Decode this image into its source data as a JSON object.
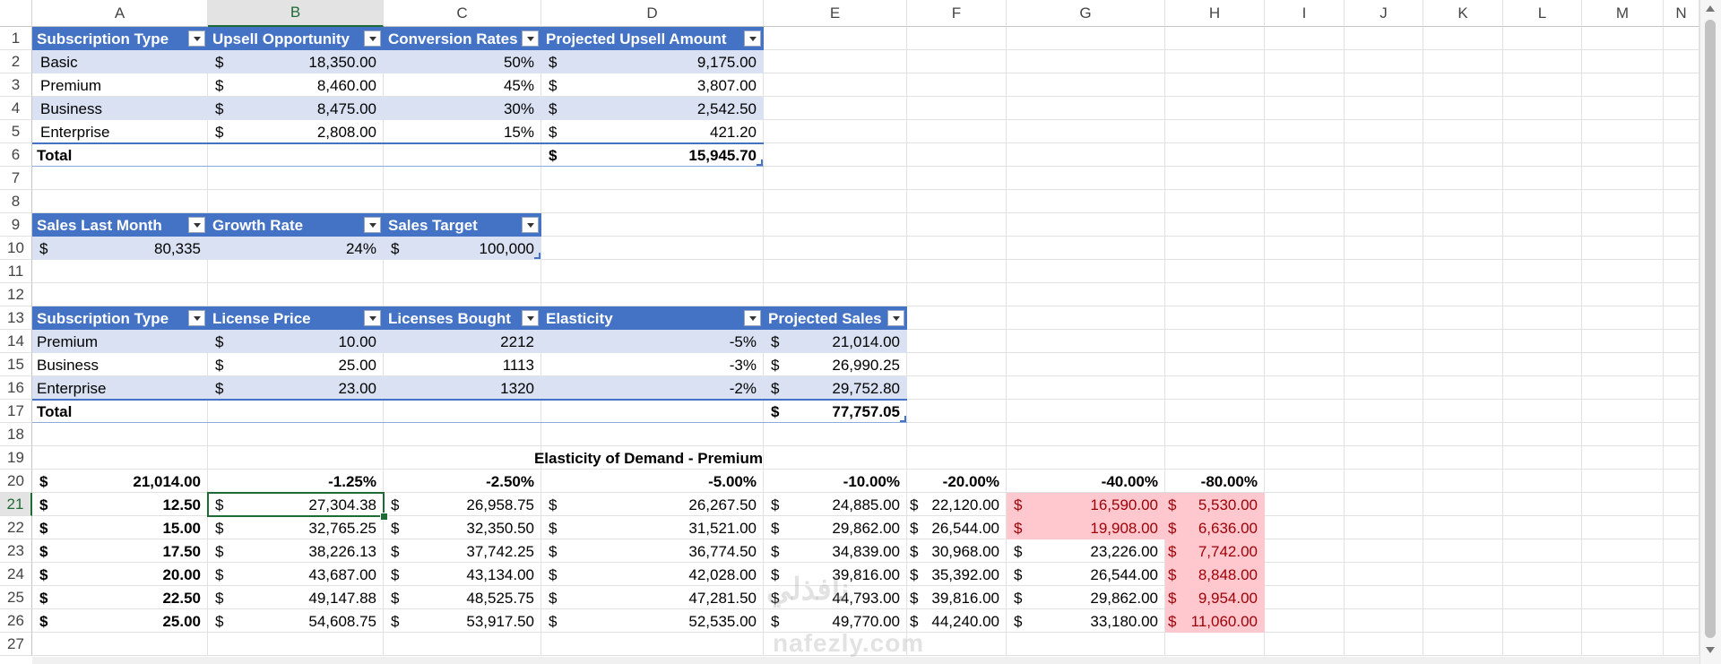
{
  "columns": [
    "A",
    "B",
    "C",
    "D",
    "E",
    "F",
    "G",
    "H",
    "I",
    "J",
    "K",
    "L",
    "M",
    "N"
  ],
  "rows": [
    "1",
    "2",
    "3",
    "4",
    "5",
    "6",
    "7",
    "8",
    "9",
    "10",
    "11",
    "12",
    "13",
    "14",
    "15",
    "16",
    "17",
    "18",
    "19",
    "20",
    "21",
    "22",
    "23",
    "24",
    "25",
    "26",
    "27"
  ],
  "selected_column": "B",
  "selected_row": "21",
  "currency": "$",
  "upsell_table": {
    "headers": [
      "Subscription Type",
      "Upsell Opportunity",
      "Conversion Rates",
      "Projected Upsell Amount"
    ],
    "rows": [
      {
        "type": "Basic",
        "opportunity": "18,350.00",
        "rate": "50%",
        "amount": "9,175.00"
      },
      {
        "type": "Premium",
        "opportunity": "8,460.00",
        "rate": "45%",
        "amount": "3,807.00"
      },
      {
        "type": "Business",
        "opportunity": "8,475.00",
        "rate": "30%",
        "amount": "2,542.50"
      },
      {
        "type": "Enterprise",
        "opportunity": "2,808.00",
        "rate": "15%",
        "amount": "421.20"
      }
    ],
    "total_label": "Total",
    "total_amount": "15,945.70"
  },
  "sales_table": {
    "headers": [
      "Sales Last Month",
      "Growth Rate",
      "Sales Target"
    ],
    "values": {
      "last_month": "80,335",
      "growth": "24%",
      "target": "100,000"
    }
  },
  "license_table": {
    "headers": [
      "Subscription Type",
      "License Price",
      "Licenses Bought",
      "Elasticity",
      "Projected Sales"
    ],
    "rows": [
      {
        "type": "Premium",
        "price": "10.00",
        "bought": "2212",
        "elasticity": "-5%",
        "sales": "21,014.00"
      },
      {
        "type": "Business",
        "price": "25.00",
        "bought": "1113",
        "elasticity": "-3%",
        "sales": "26,990.25"
      },
      {
        "type": "Enterprise",
        "price": "23.00",
        "bought": "1320",
        "elasticity": "-2%",
        "sales": "29,752.80"
      }
    ],
    "total_label": "Total",
    "total_sales": "77,757.05"
  },
  "elasticity": {
    "title": "Elasticity of Demand - Premium",
    "corner": "21,014.00",
    "headers": [
      "-1.25%",
      "-2.50%",
      "-5.00%",
      "-10.00%",
      "-20.00%",
      "-40.00%",
      "-80.00%"
    ],
    "rows": [
      {
        "price": "12.50",
        "values": [
          "27,304.38",
          "26,958.75",
          "26,267.50",
          "24,885.00",
          "22,120.00",
          "16,590.00",
          "5,530.00"
        ]
      },
      {
        "price": "15.00",
        "values": [
          "32,765.25",
          "32,350.50",
          "31,521.00",
          "29,862.00",
          "26,544.00",
          "19,908.00",
          "6,636.00"
        ]
      },
      {
        "price": "17.50",
        "values": [
          "38,226.13",
          "37,742.25",
          "36,774.50",
          "34,839.00",
          "30,968.00",
          "23,226.00",
          "7,742.00"
        ]
      },
      {
        "price": "20.00",
        "values": [
          "43,687.00",
          "43,134.00",
          "42,028.00",
          "39,816.00",
          "35,392.00",
          "26,544.00",
          "8,848.00"
        ]
      },
      {
        "price": "22.50",
        "values": [
          "49,147.88",
          "48,525.75",
          "47,281.50",
          "44,793.00",
          "39,816.00",
          "29,862.00",
          "9,954.00"
        ]
      },
      {
        "price": "25.00",
        "values": [
          "54,608.75",
          "53,917.50",
          "52,535.00",
          "49,770.00",
          "44,240.00",
          "33,180.00",
          "11,060.00"
        ]
      }
    ],
    "highlight_color": "#ffc7ce",
    "highlight_text_color": "#9c0006"
  },
  "watermark": {
    "arabic": "نافذلي",
    "latin": "nafezly.com"
  },
  "colors": {
    "table_header": "#4472c4",
    "table_band": "#d9e1f2",
    "selection": "#1e6b35"
  }
}
